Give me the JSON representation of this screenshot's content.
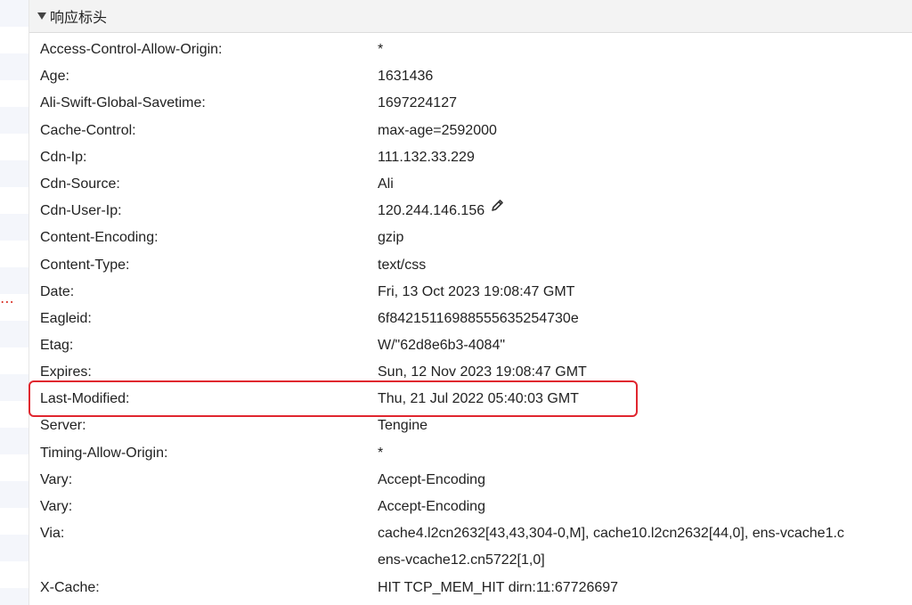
{
  "section": {
    "title": "响应标头"
  },
  "headers": [
    {
      "name": "Access-Control-Allow-Origin:",
      "value": "*"
    },
    {
      "name": "Age:",
      "value": "1631436"
    },
    {
      "name": "Ali-Swift-Global-Savetime:",
      "value": "1697224127"
    },
    {
      "name": "Cache-Control:",
      "value": "max-age=2592000"
    },
    {
      "name": "Cdn-Ip:",
      "value": "111.132.33.229"
    },
    {
      "name": "Cdn-Source:",
      "value": "Ali"
    },
    {
      "name": "Cdn-User-Ip:",
      "value": "120.244.146.156"
    },
    {
      "name": "Content-Encoding:",
      "value": "gzip"
    },
    {
      "name": "Content-Type:",
      "value": "text/css"
    },
    {
      "name": "Date:",
      "value": "Fri, 13 Oct 2023 19:08:47 GMT"
    },
    {
      "name": "Eagleid:",
      "value": "6f84215116988555635254730e"
    },
    {
      "name": "Etag:",
      "value": "W/\"62d8e6b3-4084\""
    },
    {
      "name": "Expires:",
      "value": "Sun, 12 Nov 2023 19:08:47 GMT"
    },
    {
      "name": "Last-Modified:",
      "value": "Thu, 21 Jul 2022 05:40:03 GMT"
    },
    {
      "name": "Server:",
      "value": "Tengine"
    },
    {
      "name": "Timing-Allow-Origin:",
      "value": "*"
    },
    {
      "name": "Vary:",
      "value": "Accept-Encoding"
    },
    {
      "name": "Vary:",
      "value": "Accept-Encoding"
    },
    {
      "name": "Via:",
      "value": "cache4.l2cn2632[43,43,304-0,M], cache10.l2cn2632[44,0], ens-vcache1.c"
    },
    {
      "name": "",
      "value": "ens-vcache12.cn5722[1,0]"
    },
    {
      "name": "X-Cache:",
      "value": "HIT TCP_MEM_HIT dirn:11:67726697"
    }
  ],
  "gutter_marker": "⋯",
  "colors": {
    "highlight": "#e0262f",
    "header_bg": "#f3f3f3",
    "marker": "#d93025"
  },
  "icons": {
    "edit": "pencil-icon",
    "collapse": "triangle-down-icon"
  }
}
